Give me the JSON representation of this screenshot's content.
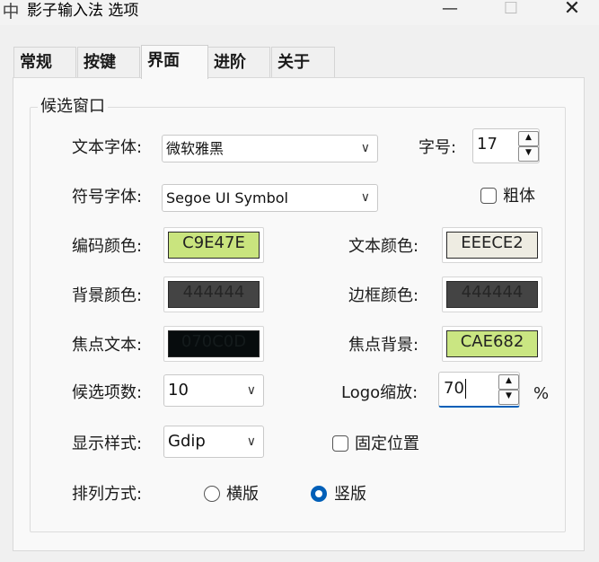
{
  "window": {
    "title": "影子输入法 选项",
    "app_icon": "中",
    "minimize_glyph": "—",
    "maximize_glyph": "☐",
    "close_glyph": "✕"
  },
  "tabs": [
    {
      "label": "常规",
      "selected": false
    },
    {
      "label": "按键",
      "selected": false
    },
    {
      "label": "界面",
      "selected": true
    },
    {
      "label": "进阶",
      "selected": false
    },
    {
      "label": "关于",
      "selected": false
    }
  ],
  "group": {
    "title": "候选窗口"
  },
  "font": {
    "text_font_label": "文本字体:",
    "text_font_value": "微软雅黑",
    "symbol_font_label": "符号字体:",
    "symbol_font_value": "Segoe UI Symbol",
    "size_label": "字号:",
    "size_value": "17",
    "bold_label": "粗体",
    "bold_checked": false
  },
  "colors": {
    "code_color_label": "编码颜色:",
    "code_color": "C9E47E",
    "text_color_label": "文本颜色:",
    "text_color": "EEECE2",
    "bg_color_label": "背景颜色:",
    "bg_color": "444444",
    "border_color_label": "边框颜色:",
    "border_color": "444444",
    "focus_text_label": "焦点文本:",
    "focus_text_color": "070C0D",
    "focus_bg_label": "焦点背景:",
    "focus_bg_color": "CAE682",
    "swatch_text_dark": "#333333",
    "swatch_text_light": "#222222"
  },
  "options": {
    "candidate_count_label": "候选项数:",
    "candidate_count_value": "10",
    "logo_scale_label": "Logo缩放:",
    "logo_scale_value": "70",
    "logo_scale_unit": "%",
    "display_style_label": "显示样式:",
    "display_style_value": "Gdip",
    "fixed_position_label": "固定位置",
    "fixed_position_checked": false,
    "layout_label": "排列方式:",
    "layout_horizontal_label": "横版",
    "layout_vertical_label": "竖版",
    "layout_selected": "竖版"
  },
  "icons": {
    "chevron": "∨",
    "spin_up": "▲",
    "spin_down": "▼"
  },
  "accent_color": "#005fb8"
}
